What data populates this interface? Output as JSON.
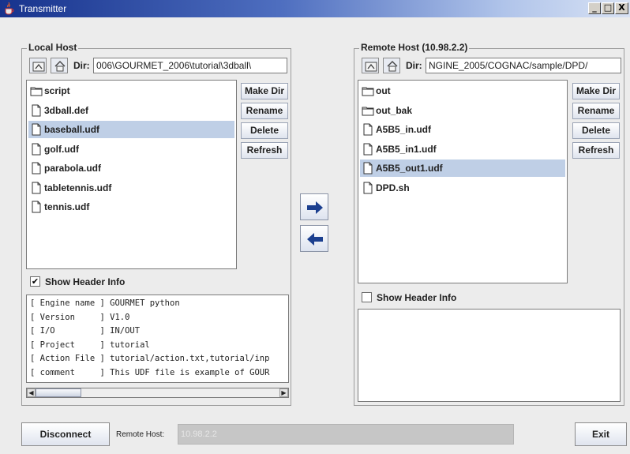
{
  "window": {
    "title": "Transmitter",
    "minimize": "_",
    "maximize": "□",
    "close": "X"
  },
  "local": {
    "group_title": "Local Host",
    "dir_label": "Dir:",
    "dir_value": "006\\GOURMET_2006\\tutorial\\3dball\\",
    "files": [
      {
        "name": "script",
        "type": "folder"
      },
      {
        "name": "3dball.def",
        "type": "file"
      },
      {
        "name": "baseball.udf",
        "type": "file",
        "selected": true
      },
      {
        "name": "golf.udf",
        "type": "file"
      },
      {
        "name": "parabola.udf",
        "type": "file"
      },
      {
        "name": "tabletennis.udf",
        "type": "file"
      },
      {
        "name": "tennis.udf",
        "type": "file"
      }
    ],
    "buttons": [
      "Make Dir",
      "Rename",
      "Delete",
      "Refresh"
    ],
    "show_header_label": "Show Header Info",
    "show_header_checked": true,
    "header_info": [
      "[ Engine name ] GOURMET python",
      "[ Version     ] V1.0",
      "[ I/O         ] IN/OUT",
      "[ Project     ] tutorial",
      "[ Action File ] tutorial/action.txt,tutorial/inp",
      "[ comment     ] This UDF file is example of GOUR"
    ]
  },
  "remote": {
    "group_title": "Remote Host (10.98.2.2)",
    "dir_label": "Dir:",
    "dir_value": "NGINE_2005/COGNAC/sample/DPD/",
    "files": [
      {
        "name": "out",
        "type": "folder"
      },
      {
        "name": "out_bak",
        "type": "folder"
      },
      {
        "name": "A5B5_in.udf",
        "type": "file"
      },
      {
        "name": "A5B5_in1.udf",
        "type": "file"
      },
      {
        "name": "A5B5_out1.udf",
        "type": "file",
        "selected": true
      },
      {
        "name": "DPD.sh",
        "type": "file"
      }
    ],
    "buttons": [
      "Make Dir",
      "Rename",
      "Delete",
      "Refresh"
    ],
    "show_header_label": "Show Header Info",
    "show_header_checked": false
  },
  "transfer": {
    "upload_icon": "arrow-right-icon",
    "download_icon": "arrow-left-icon"
  },
  "bottom": {
    "disconnect_label": "Disconnect",
    "remote_host_label": "Remote Host:",
    "remote_host_value": "10.98.2.2",
    "exit_label": "Exit"
  },
  "colors": {
    "selection": "#bfcfe6",
    "titlebar_start": "#17338d",
    "arrow": "#1b3f8f"
  }
}
